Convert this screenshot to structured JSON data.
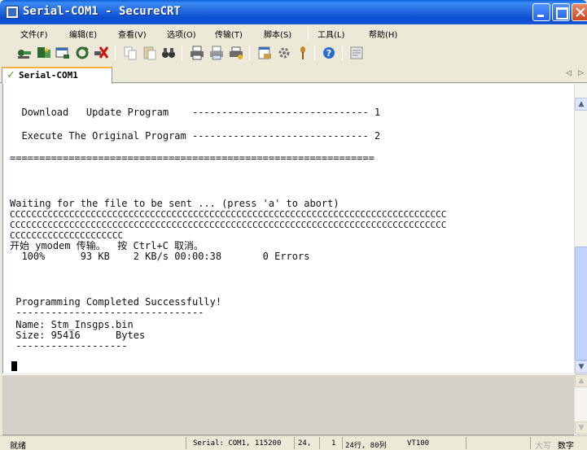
{
  "window": {
    "title": "Serial-COM1 - SecureCRT"
  },
  "menu": [
    "文件(F)",
    "编辑(E)",
    "查看(V)",
    "选项(O)",
    "传输(T)",
    "脚本(S)",
    "工具(L)",
    "帮助(H)"
  ],
  "toolbar_icons": [
    "connect-icon",
    "quick-connect-icon",
    "connect-tab-icon",
    "reconnect-icon",
    "disconnect-icon",
    "copy-icon",
    "paste-icon",
    "find-icon",
    "print-icon",
    "print-selection-icon",
    "print-setup-icon",
    "session-options-icon",
    "global-options-icon",
    "keymap-icon",
    "help-icon",
    "log-icon"
  ],
  "tab": {
    "label": "Serial-COM1",
    "status": "connected"
  },
  "terminal": {
    "lines": [
      "  Download   Update Program    ------------------------------ 1",
      "",
      "  Execute The Original Program ------------------------------ 2",
      "",
      "==============================================================",
      "",
      "",
      "",
      "Waiting for the file to be sent ... (press 'a' to abort)",
      "CCCCCCCCCCCCCCCCCCCCCCCCCCCCCCCCCCCCCCCCCCCCCCCCCCCCCCCCCCCCCCCCCCCCCCCCCCCCCCCCC",
      "CCCCCCCCCCCCCCCCCCCCCCCCCCCCCCCCCCCCCCCCCCCCCCCCCCCCCCCCCCCCCCCCCCCCCCCCCCCCCCCCC",
      "CCCCCCCCCCCCCCCCCCCCC",
      "开始 ymodem 传输。  按 Ctrl+C 取消。",
      "  100%      93 KB    2 KB/s 00:00:38       0 Errors",
      "",
      "",
      "",
      " Programming Completed Successfully!",
      " --------------------------------",
      " Name: Stm_Insgps.bin",
      " Size: 95416      Bytes",
      " -------------------"
    ]
  },
  "statusbar": {
    "ready": "就绪",
    "connection": "Serial: COM1, 115200",
    "row": "24,",
    "col": "1",
    "size": "24行, 80列",
    "emulation": "VT100",
    "caps": "大写",
    "num": "数字"
  },
  "colors": {
    "titlebar": "#2468e0",
    "tab_accent": "#f6b03e",
    "terminal_bg": "#ffffff",
    "lower_pane": "#d4d0c8"
  }
}
